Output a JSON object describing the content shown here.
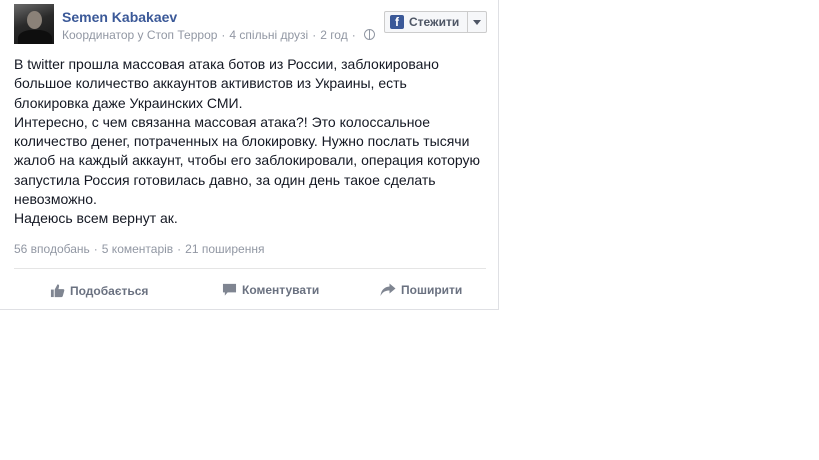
{
  "post": {
    "author": "Semen Kabakaev",
    "meta": {
      "role": "Координатор у Стоп Террор",
      "mutual_friends": "4 спільні друзі",
      "time": "2 год"
    },
    "follow_button": "Стежити",
    "body_lines": [
      "В twitter прошла массовая атака ботов из России, заблокировано",
      "большое количество аккаунтов активистов из Украины, есть",
      "блокировка даже Украинских СМИ.",
      "Интересно, с чем связанна массовая атака?! Это колоссальное",
      "количество денег, потраченных на блокировку. Нужно послать тысячи",
      "жалоб на каждый аккаунт, чтобы его заблокировали, операция которую",
      "запустила Россия готовилась давно, за один день такое сделать",
      "невозможно.",
      "Надеюсь всем вернут ак."
    ],
    "stats": {
      "likes": "56 вподобань",
      "comments": "5 коментарів",
      "shares": "21 поширення"
    },
    "actions": {
      "like": "Подобається",
      "comment": "Коментувати",
      "share": "Поширити"
    },
    "icons": {
      "follow": "facebook-icon",
      "privacy": "globe-icon",
      "like": "thumbs-up-icon",
      "comment": "comment-icon",
      "share": "share-arrow-icon"
    },
    "colors": {
      "link": "#3b5998",
      "muted": "#9197a3",
      "action": "#6a7180"
    }
  }
}
